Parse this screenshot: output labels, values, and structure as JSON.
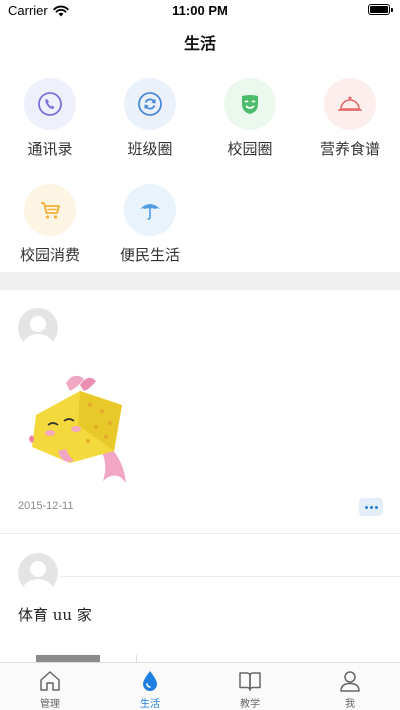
{
  "status_bar": {
    "carrier": "Carrier",
    "time": "11:00 PM"
  },
  "nav": {
    "title": "生活"
  },
  "grid": [
    {
      "label": "通讯录",
      "icon": "phone-icon",
      "bg": "#eef0fb",
      "color": "#7b72d8"
    },
    {
      "label": "班级圈",
      "icon": "refresh-circle-icon",
      "bg": "#eaf1fb",
      "color": "#4a8ad6"
    },
    {
      "label": "校园圈",
      "icon": "mask-icon",
      "bg": "#ebf8ee",
      "color": "#4bbd6a"
    },
    {
      "label": "营养食谱",
      "icon": "food-cloche-icon",
      "bg": "#fdeeee",
      "color": "#e46a6a"
    },
    {
      "label": "校园消费",
      "icon": "shopping-cart-icon",
      "bg": "#fef4e4",
      "color": "#f2b136"
    },
    {
      "label": "便民生活",
      "icon": "umbrella-icon",
      "bg": "#e9f3fc",
      "color": "#4f9ce0"
    }
  ],
  "feed": {
    "post1": {
      "date": "2015-12-11"
    },
    "post2": {
      "text": "体育 uu 家"
    }
  },
  "tabs": [
    {
      "label": "管理",
      "icon": "home-icon"
    },
    {
      "label": "生活",
      "icon": "water-drop-icon"
    },
    {
      "label": "教学",
      "icon": "open-book-icon"
    },
    {
      "label": "我",
      "icon": "person-icon"
    }
  ],
  "colors": {
    "accent": "#1e7fe0",
    "band": "#efefef"
  }
}
